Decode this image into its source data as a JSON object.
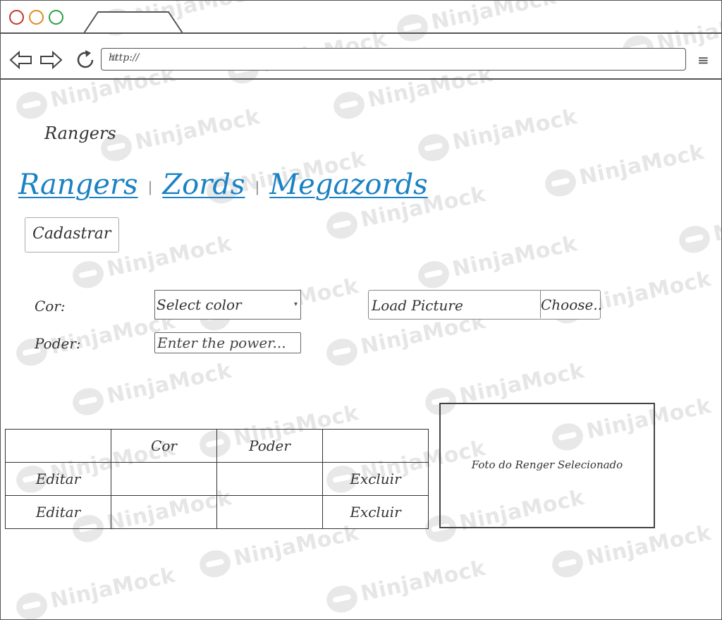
{
  "browser": {
    "url": "http://",
    "traffic_lights": [
      "#c0392b",
      "#e67e22",
      "#27ae60"
    ]
  },
  "watermark": "NinjaMock",
  "page": {
    "title": "Rangers",
    "nav_links": [
      "Rangers",
      "Zords",
      "Megazords"
    ],
    "register_button": "Cadastrar",
    "form": {
      "color_label": "Cor:",
      "color_select_value": "Select color",
      "power_label": "Poder:",
      "power_placeholder": "Enter the power...",
      "picture_placeholder": "Load Picture",
      "choose_button": "Choose.."
    },
    "table": {
      "headers": [
        "",
        "Cor",
        "Poder",
        ""
      ],
      "rows": [
        [
          "Editar",
          "",
          "",
          "Excluir"
        ],
        [
          "Editar",
          "",
          "",
          "Excluir"
        ]
      ]
    },
    "photo_caption": "Foto do Renger Selecionado"
  },
  "colors": {
    "link": "#1a82c4"
  }
}
